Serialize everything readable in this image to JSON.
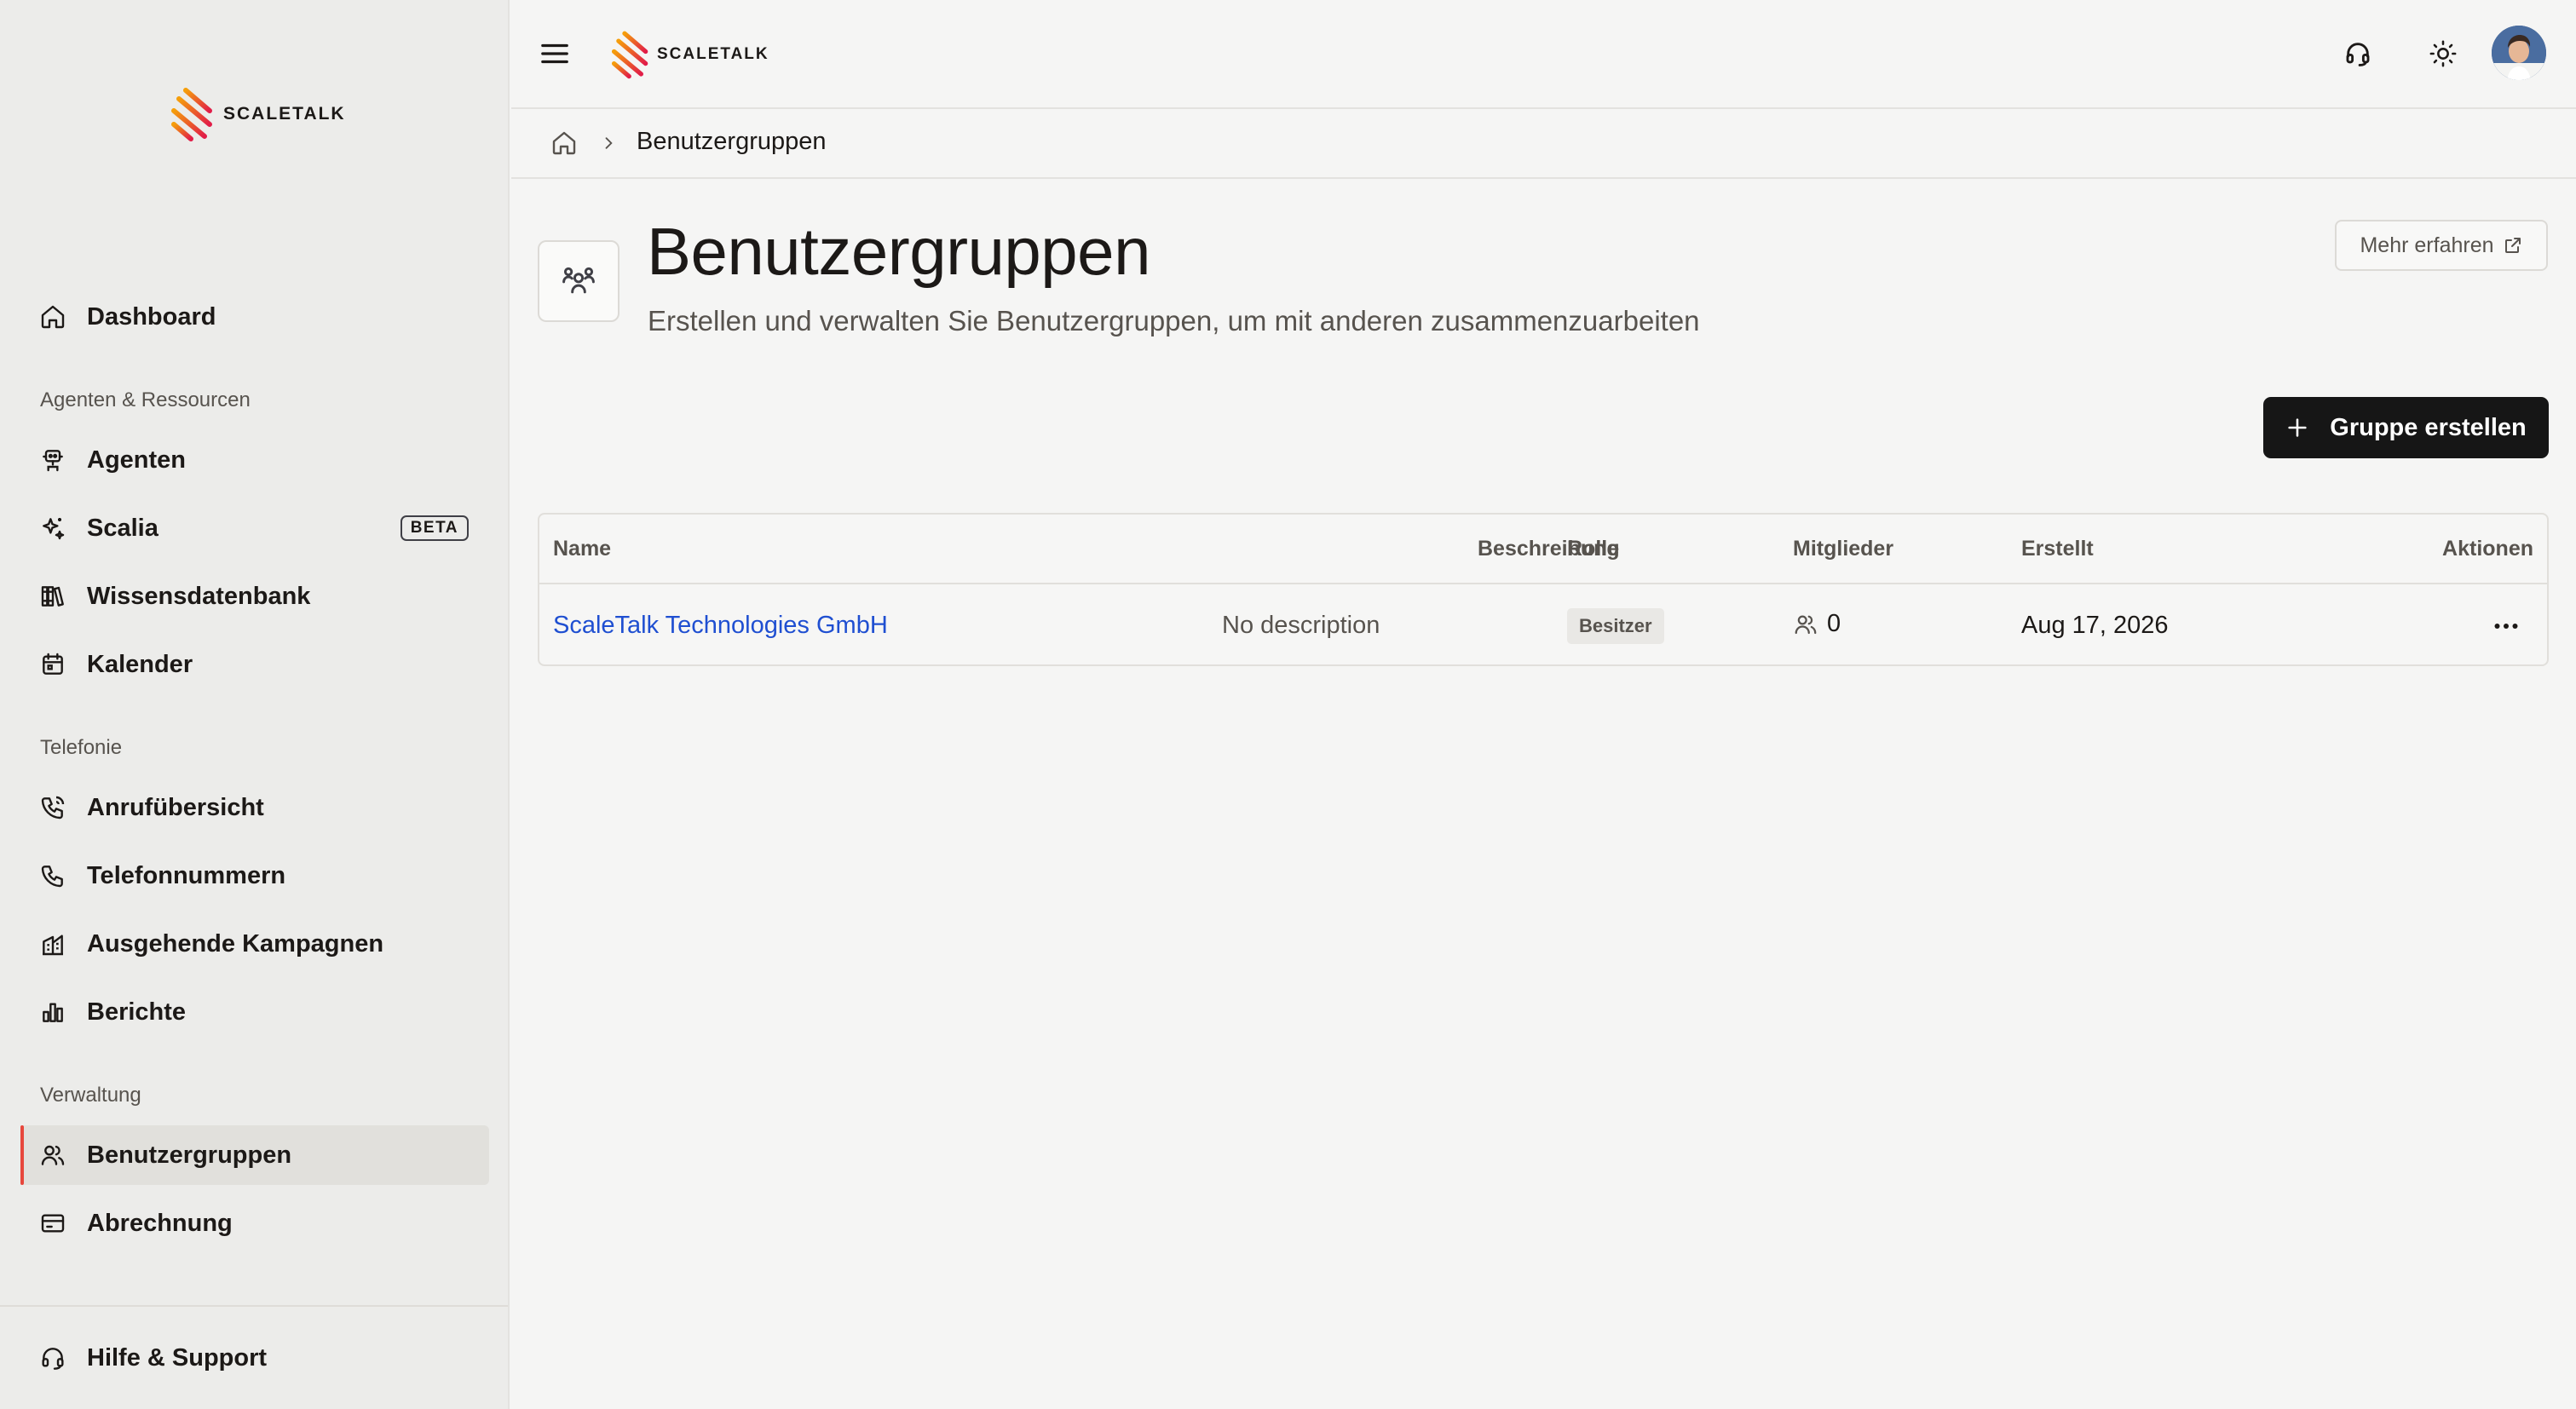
{
  "brand": {
    "name": "SCALETALK",
    "colors": {
      "accent": "#e7473c",
      "logo_gradient": [
        "#f59e0b",
        "#e11d48"
      ],
      "link": "#1f4fd1",
      "primary_button": "#161616"
    }
  },
  "sidebar": {
    "dashboard": {
      "label": "Dashboard",
      "icon": "home-icon"
    },
    "sections": [
      {
        "label": "Agenten & Ressourcen",
        "items": [
          {
            "label": "Agenten",
            "icon": "robot-icon"
          },
          {
            "label": "Scalia",
            "icon": "sparkles-icon",
            "badge": "BETA"
          },
          {
            "label": "Wissensdatenbank",
            "icon": "library-icon"
          },
          {
            "label": "Kalender",
            "icon": "calendar-icon"
          }
        ]
      },
      {
        "label": "Telefonie",
        "items": [
          {
            "label": "Anrufübersicht",
            "icon": "phone-call-icon"
          },
          {
            "label": "Telefonnummern",
            "icon": "phone-icon"
          },
          {
            "label": "Ausgehende Kampagnen",
            "icon": "campaign-icon"
          },
          {
            "label": "Berichte",
            "icon": "bar-chart-icon"
          }
        ]
      },
      {
        "label": "Verwaltung",
        "items": [
          {
            "label": "Benutzergruppen",
            "icon": "users-icon",
            "active": true
          },
          {
            "label": "Abrechnung",
            "icon": "credit-card-icon"
          }
        ]
      }
    ],
    "footer": {
      "label": "Hilfe & Support",
      "icon": "headset-icon"
    }
  },
  "topbar": {
    "icons": [
      "menu-icon",
      "headset-icon",
      "sun-icon",
      "avatar"
    ]
  },
  "breadcrumb": {
    "home_icon": "home-icon",
    "current": "Benutzergruppen"
  },
  "page": {
    "icon": "user-group-icon",
    "title": "Benutzergruppen",
    "subtitle": "Erstellen und verwalten Sie Benutzergruppen, um mit anderen zusammenzuarbeiten",
    "learn_more": "Mehr erfahren",
    "create_button": "Gruppe erstellen"
  },
  "table": {
    "columns": [
      "Name",
      "Beschreibung",
      "Rolle",
      "Mitglieder",
      "Erstellt",
      "Aktionen"
    ],
    "rows": [
      {
        "name": "ScaleTalk Technologies GmbH",
        "description": "No description",
        "role": "Besitzer",
        "members": "0",
        "created": "Aug 17, 2026"
      }
    ]
  }
}
